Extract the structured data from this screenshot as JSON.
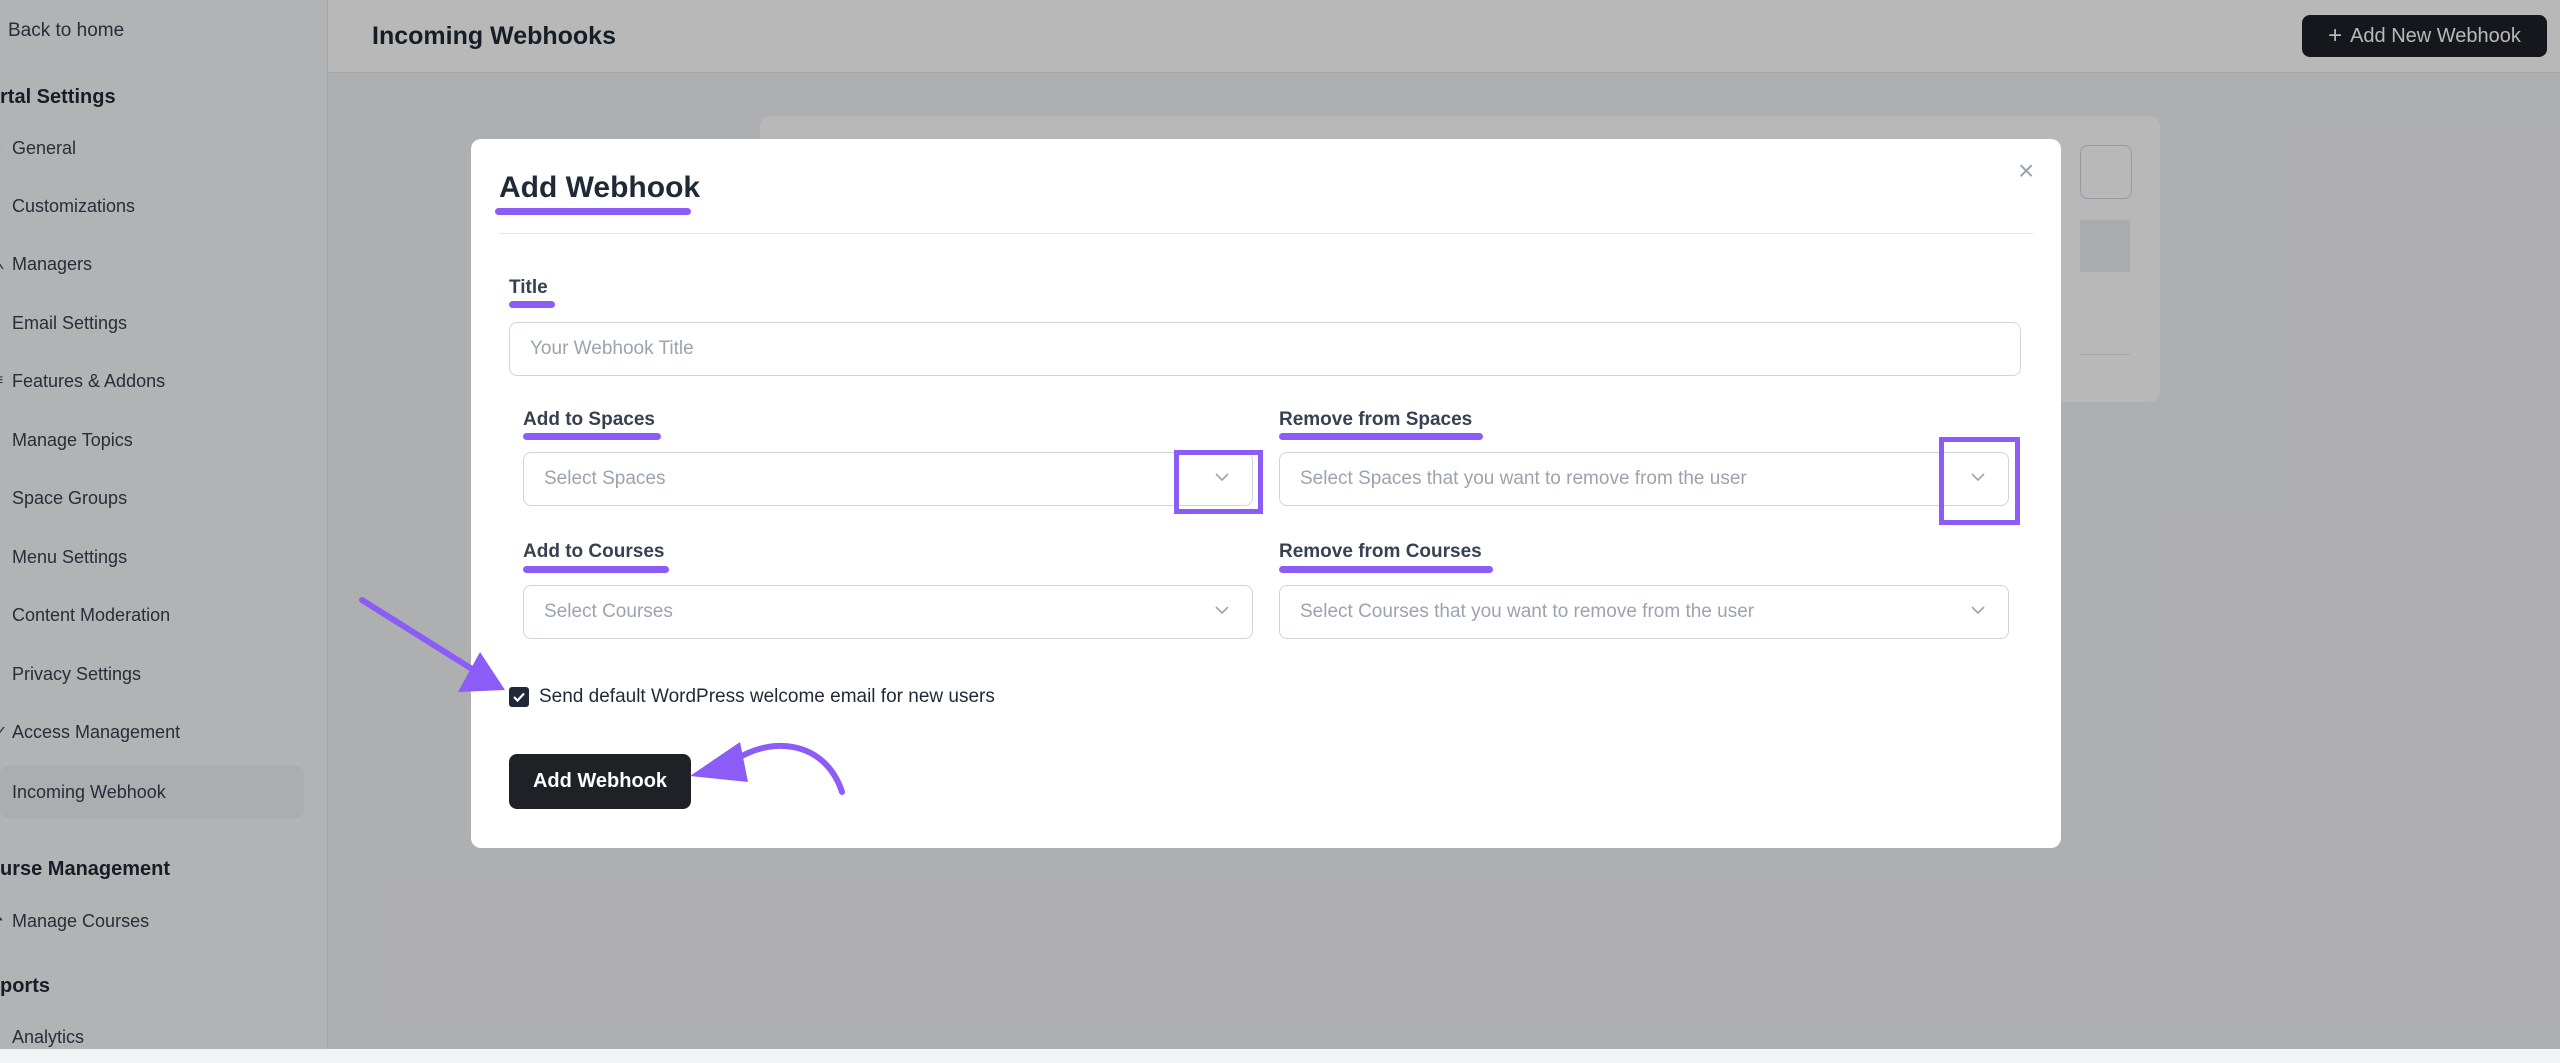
{
  "sidebar": {
    "back_label": "Back to home",
    "sections": [
      {
        "title": "rtal Settings"
      },
      {
        "title": "urse Management"
      },
      {
        "title": "ports"
      }
    ],
    "items": [
      {
        "label": "General",
        "icon": "settings-icon"
      },
      {
        "label": "Customizations",
        "icon": "customize-icon"
      },
      {
        "label": "Managers",
        "icon": "users-icon"
      },
      {
        "label": "Email Settings",
        "icon": "mail-icon"
      },
      {
        "label": "Features & Addons",
        "icon": "grid-icon"
      },
      {
        "label": "Manage Topics",
        "icon": "tag-icon"
      },
      {
        "label": "Space Groups",
        "icon": "folder-icon"
      },
      {
        "label": "Menu Settings",
        "icon": "menu-icon"
      },
      {
        "label": "Content Moderation",
        "icon": "shield-icon"
      },
      {
        "label": "Privacy Settings",
        "icon": "lock-icon"
      },
      {
        "label": "Access Management",
        "icon": "key-icon"
      },
      {
        "label": "Incoming Webhook",
        "icon": "webhook-icon"
      },
      {
        "label": "Manage Courses",
        "icon": "book-icon"
      },
      {
        "label": "Analytics",
        "icon": "chart-icon"
      }
    ],
    "active_item": "Incoming Webhook"
  },
  "header": {
    "title": "Incoming Webhooks",
    "add_new_label": "Add New Webhook"
  },
  "modal": {
    "title": "Add Webhook",
    "title_label": "Title",
    "title_placeholder": "Your Webhook Title",
    "add_spaces_label": "Add to Spaces",
    "add_spaces_placeholder": "Select Spaces",
    "remove_spaces_label": "Remove from Spaces",
    "remove_spaces_placeholder": "Select Spaces that you want to remove from the user",
    "add_courses_label": "Add to Courses",
    "add_courses_placeholder": "Select Courses",
    "remove_courses_label": "Remove from Courses",
    "remove_courses_placeholder": "Select Courses that you want to remove from the user",
    "welcome_email_label": "Send default WordPress welcome email for new users",
    "welcome_email_checked": true,
    "submit_label": "Add Webhook"
  },
  "colors": {
    "annotation": "#8b5cf6",
    "primary_button": "#1f2127"
  }
}
